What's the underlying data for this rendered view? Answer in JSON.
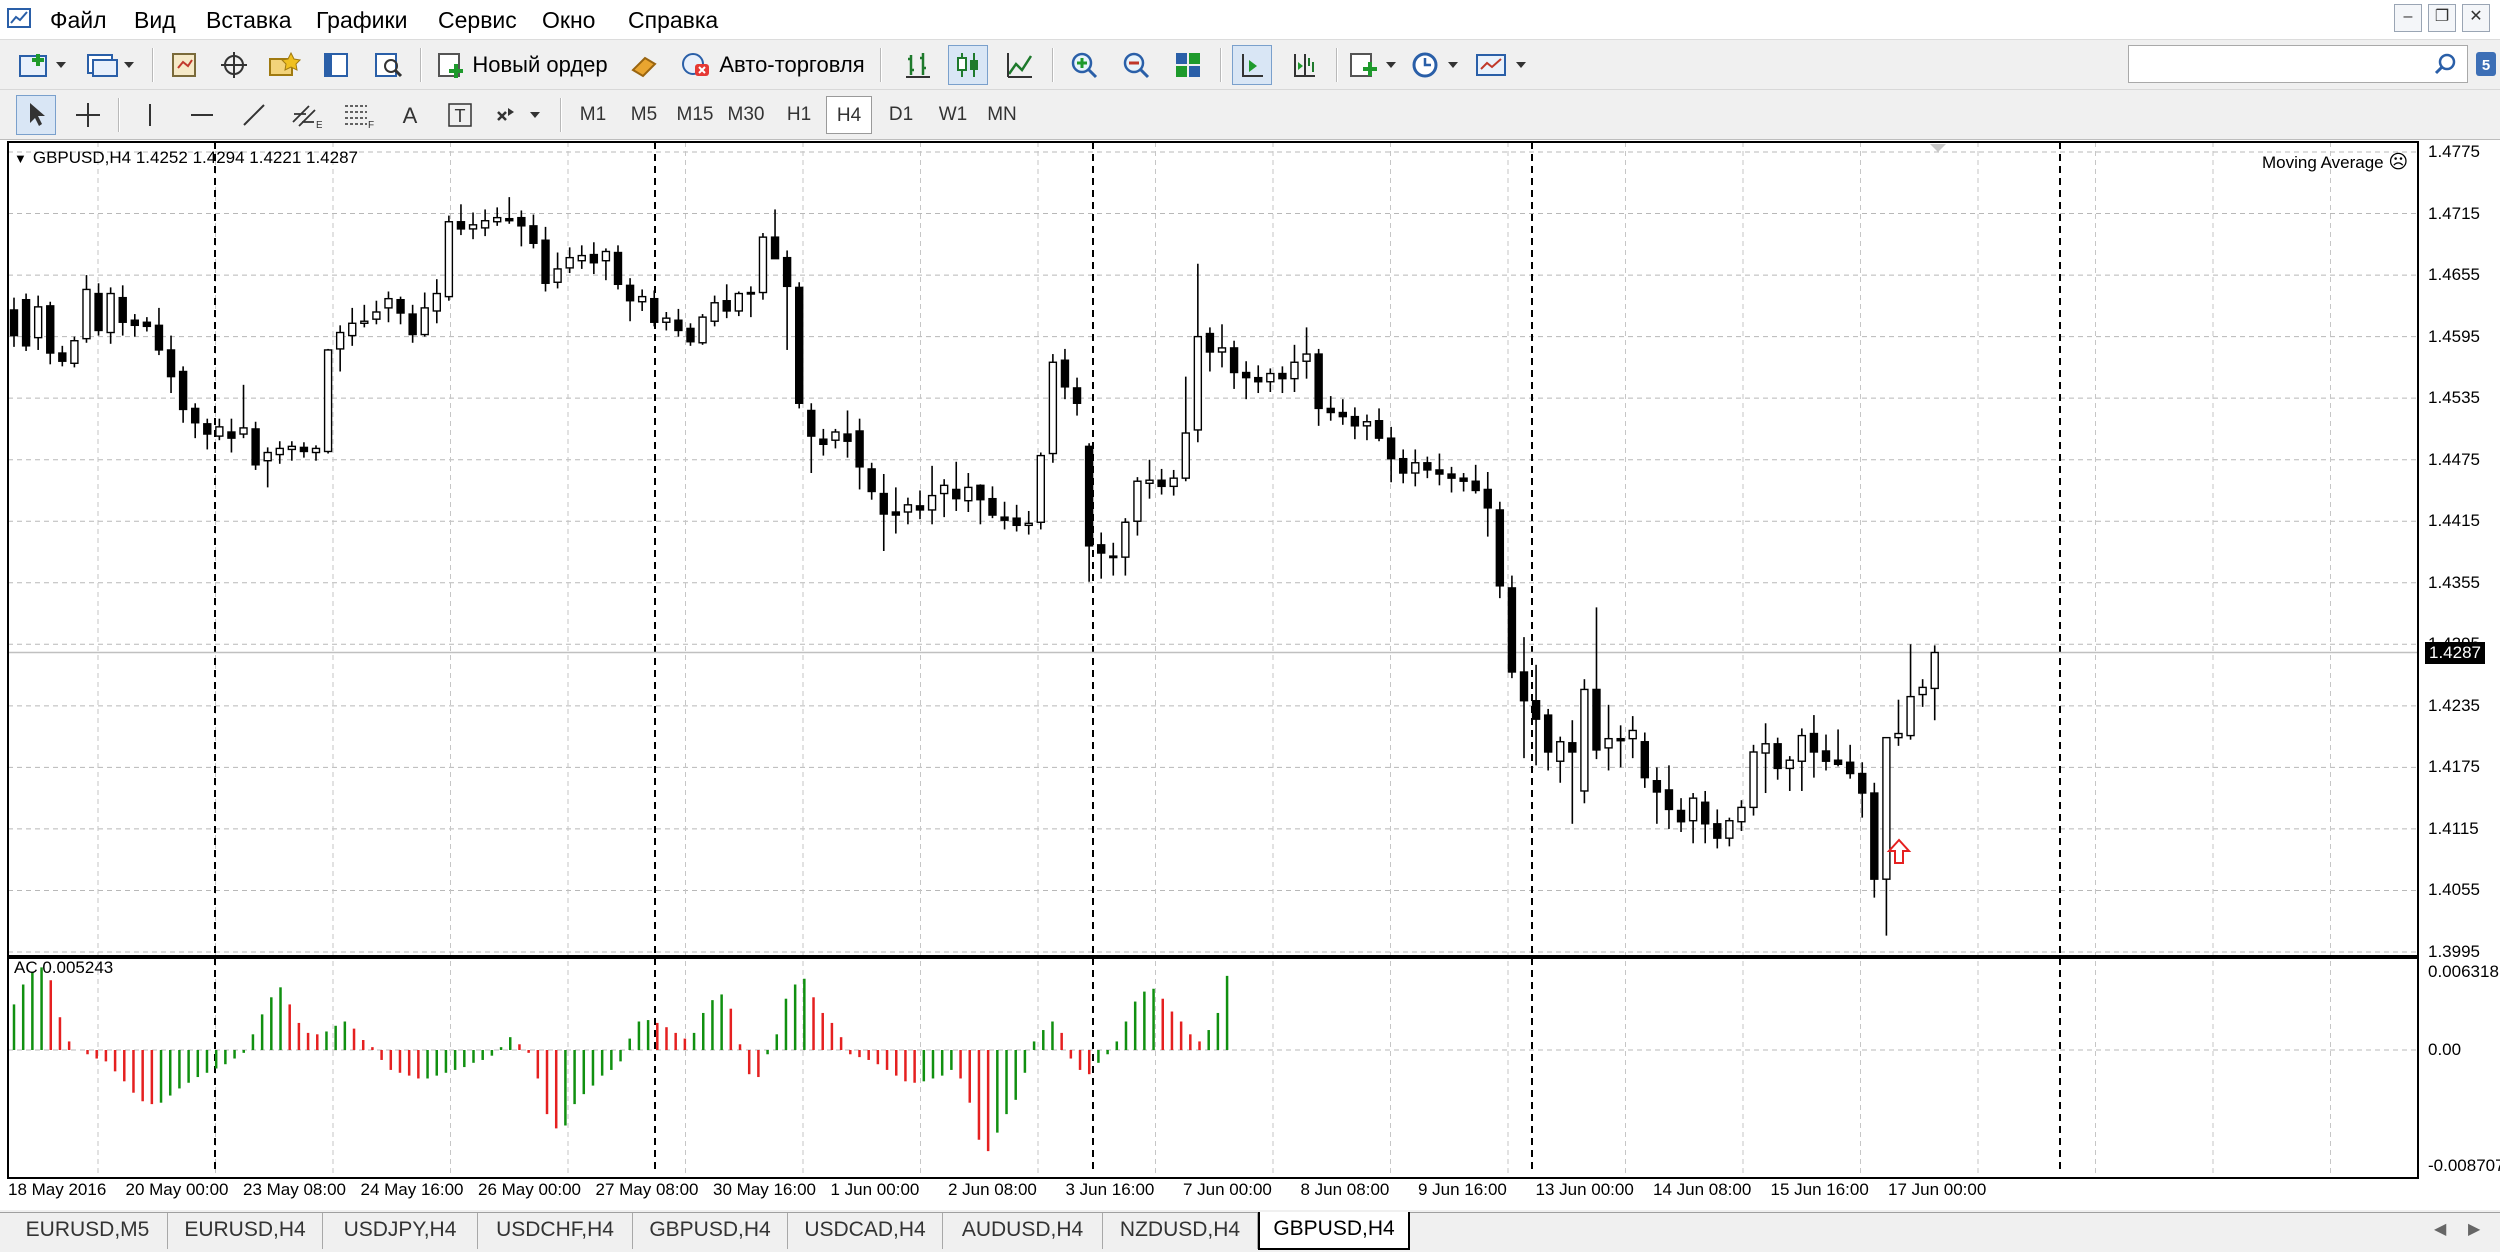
{
  "menu": {
    "items": [
      "Файл",
      "Вид",
      "Вставка",
      "Графики",
      "Сервис",
      "Окно",
      "Справка"
    ]
  },
  "toolbar": {
    "new_order_label": "Новый ордер",
    "auto_trading_label": "Авто-торговля",
    "search_value": ""
  },
  "timeframes": [
    "M1",
    "M5",
    "M15",
    "M30",
    "H1",
    "H4",
    "D1",
    "W1",
    "MN"
  ],
  "active_timeframe": "H4",
  "chart": {
    "info": "GBPUSD,H4  1.4252 1.4294 1.4221 1.4287",
    "indicator_label": "Moving Average",
    "current_price": "1.4287",
    "ac_label": "AC 0.005243",
    "price_ticks": [
      "1.4775",
      "1.4715",
      "1.4655",
      "1.4595",
      "1.4535",
      "1.4475",
      "1.4415",
      "1.4355",
      "1.4295",
      "1.4235",
      "1.4175",
      "1.4115",
      "1.4055",
      "1.3995"
    ],
    "ac_ticks": [
      "0.006318",
      "0.00",
      "-0.008707"
    ],
    "date_labels": [
      "18 May 2016",
      "20 May 00:00",
      "23 May 08:00",
      "24 May 16:00",
      "26 May 00:00",
      "27 May 08:00",
      "30 May 16:00",
      "1 Jun 00:00",
      "2 Jun 08:00",
      "3 Jun 16:00",
      "7 Jun 00:00",
      "8 Jun 08:00",
      "9 Jun 16:00",
      "13 Jun 00:00",
      "14 Jun 08:00",
      "15 Jun 16:00",
      "17 Jun 00:00"
    ]
  },
  "chart_data": {
    "type": "candlestick",
    "symbol": "GBPUSD",
    "timeframe": "H4",
    "ylim": [
      1.3995,
      1.4775
    ],
    "candles": [
      [
        1.4621,
        1.4633,
        1.4585,
        1.4596
      ],
      [
        1.4631,
        1.4637,
        1.4581,
        1.4586
      ],
      [
        1.4594,
        1.4635,
        1.4582,
        1.4624
      ],
      [
        1.4625,
        1.4629,
        1.4568,
        1.4579
      ],
      [
        1.4579,
        1.4586,
        1.4566,
        1.4571
      ],
      [
        1.4569,
        1.4595,
        1.4565,
        1.4591
      ],
      [
        1.4593,
        1.4655,
        1.4589,
        1.4641
      ],
      [
        1.4637,
        1.4647,
        1.4596,
        1.4601
      ],
      [
        1.4599,
        1.4643,
        1.4588,
        1.4637
      ],
      [
        1.4633,
        1.4645,
        1.4596,
        1.4609
      ],
      [
        1.4611,
        1.4617,
        1.4595,
        1.4606
      ],
      [
        1.4609,
        1.4614,
        1.46,
        1.4605
      ],
      [
        1.4606,
        1.4623,
        1.4577,
        1.4582
      ],
      [
        1.4582,
        1.4596,
        1.454,
        1.4556
      ],
      [
        1.4561,
        1.4566,
        1.4511,
        1.4524
      ],
      [
        1.4525,
        1.453,
        1.4496,
        1.4511
      ],
      [
        1.451,
        1.4515,
        1.4485,
        1.45
      ],
      [
        1.4498,
        1.4515,
        1.4494,
        1.4507
      ],
      [
        1.4502,
        1.4515,
        1.4482,
        1.4496
      ],
      [
        1.45,
        1.4548,
        1.4496,
        1.4506
      ],
      [
        1.4505,
        1.4512,
        1.4465,
        1.447
      ],
      [
        1.4474,
        1.4487,
        1.4448,
        1.4482
      ],
      [
        1.448,
        1.4493,
        1.4471,
        1.4486
      ],
      [
        1.4485,
        1.4493,
        1.4474,
        1.4488
      ],
      [
        1.4487,
        1.4492,
        1.4477,
        1.4483
      ],
      [
        1.4482,
        1.4489,
        1.4474,
        1.4486
      ],
      [
        1.4483,
        1.4583,
        1.4481,
        1.4582
      ],
      [
        1.4583,
        1.4606,
        1.4561,
        1.4599
      ],
      [
        1.4596,
        1.4623,
        1.4586,
        1.4608
      ],
      [
        1.4608,
        1.4626,
        1.4604,
        1.461
      ],
      [
        1.4612,
        1.463,
        1.4607,
        1.4619
      ],
      [
        1.4623,
        1.4639,
        1.4609,
        1.4632
      ],
      [
        1.4631,
        1.4634,
        1.4607,
        1.4618
      ],
      [
        1.4617,
        1.4626,
        1.4589,
        1.4597
      ],
      [
        1.4597,
        1.4638,
        1.4595,
        1.4623
      ],
      [
        1.462,
        1.4651,
        1.4608,
        1.4637
      ],
      [
        1.4634,
        1.4713,
        1.463,
        1.4707
      ],
      [
        1.4707,
        1.4724,
        1.4694,
        1.47
      ],
      [
        1.47,
        1.4716,
        1.469,
        1.4704
      ],
      [
        1.4701,
        1.4719,
        1.4693,
        1.4708
      ],
      [
        1.4707,
        1.4721,
        1.4703,
        1.4711
      ],
      [
        1.471,
        1.4731,
        1.4705,
        1.4708
      ],
      [
        1.4711,
        1.4718,
        1.4683,
        1.4703
      ],
      [
        1.4703,
        1.4714,
        1.4681,
        1.4686
      ],
      [
        1.4689,
        1.4702,
        1.4639,
        1.4647
      ],
      [
        1.4648,
        1.4677,
        1.4642,
        1.4661
      ],
      [
        1.4662,
        1.4682,
        1.4657,
        1.4672
      ],
      [
        1.4669,
        1.4684,
        1.4661,
        1.4674
      ],
      [
        1.4675,
        1.4687,
        1.4656,
        1.4667
      ],
      [
        1.4669,
        1.4681,
        1.465,
        1.4678
      ],
      [
        1.4677,
        1.4684,
        1.4641,
        1.4646
      ],
      [
        1.4645,
        1.4652,
        1.461,
        1.463
      ],
      [
        1.4629,
        1.4641,
        1.462,
        1.4634
      ],
      [
        1.4632,
        1.464,
        1.4605,
        1.4609
      ],
      [
        1.4609,
        1.4619,
        1.4601,
        1.4613
      ],
      [
        1.4611,
        1.4622,
        1.4595,
        1.4601
      ],
      [
        1.4603,
        1.4608,
        1.4586,
        1.459
      ],
      [
        1.4589,
        1.4617,
        1.4587,
        1.4614
      ],
      [
        1.461,
        1.4635,
        1.4605,
        1.4628
      ],
      [
        1.463,
        1.4646,
        1.4613,
        1.462
      ],
      [
        1.462,
        1.4639,
        1.4615,
        1.4637
      ],
      [
        1.4638,
        1.4644,
        1.4614,
        1.4637
      ],
      [
        1.4638,
        1.4696,
        1.4631,
        1.4692
      ],
      [
        1.4692,
        1.4719,
        1.4681,
        1.4671
      ],
      [
        1.4672,
        1.4679,
        1.4582,
        1.4644
      ],
      [
        1.4643,
        1.4648,
        1.4525,
        1.453
      ],
      [
        1.4523,
        1.453,
        1.4462,
        1.4498
      ],
      [
        1.4495,
        1.4505,
        1.4479,
        1.449
      ],
      [
        1.4494,
        1.4505,
        1.4486,
        1.4502
      ],
      [
        1.45,
        1.4523,
        1.4477,
        1.4493
      ],
      [
        1.4503,
        1.4515,
        1.4446,
        1.4468
      ],
      [
        1.4466,
        1.4472,
        1.4436,
        1.4444
      ],
      [
        1.4442,
        1.4461,
        1.4386,
        1.4422
      ],
      [
        1.4424,
        1.4448,
        1.4403,
        1.4421
      ],
      [
        1.4424,
        1.4438,
        1.4412,
        1.4431
      ],
      [
        1.443,
        1.4445,
        1.4417,
        1.4426
      ],
      [
        1.4426,
        1.4469,
        1.4412,
        1.444
      ],
      [
        1.4442,
        1.4456,
        1.4419,
        1.445
      ],
      [
        1.4446,
        1.4473,
        1.4425,
        1.4437
      ],
      [
        1.4435,
        1.4462,
        1.4424,
        1.4448
      ],
      [
        1.445,
        1.4451,
        1.4412,
        1.4436
      ],
      [
        1.4437,
        1.4449,
        1.4418,
        1.4421
      ],
      [
        1.4419,
        1.4434,
        1.4407,
        1.4416
      ],
      [
        1.4418,
        1.4431,
        1.4405,
        1.4411
      ],
      [
        1.4411,
        1.4425,
        1.4402,
        1.4413
      ],
      [
        1.4414,
        1.4482,
        1.4407,
        1.4479
      ],
      [
        1.4481,
        1.4578,
        1.4472,
        1.457
      ],
      [
        1.4572,
        1.4583,
        1.4534,
        1.4546
      ],
      [
        1.4545,
        1.4555,
        1.4518,
        1.453
      ],
      [
        1.4488,
        1.4491,
        1.4356,
        1.4391
      ],
      [
        1.4392,
        1.4404,
        1.4359,
        1.4384
      ],
      [
        1.4381,
        1.4394,
        1.4362,
        1.438
      ],
      [
        1.438,
        1.4418,
        1.4362,
        1.4414
      ],
      [
        1.4415,
        1.4458,
        1.4401,
        1.4454
      ],
      [
        1.4452,
        1.4475,
        1.4437,
        1.4455
      ],
      [
        1.4455,
        1.4466,
        1.4441,
        1.4449
      ],
      [
        1.4449,
        1.4465,
        1.444,
        1.4457
      ],
      [
        1.4457,
        1.4556,
        1.4454,
        1.4501
      ],
      [
        1.4504,
        1.4666,
        1.4492,
        1.4595
      ],
      [
        1.4598,
        1.4604,
        1.4561,
        1.458
      ],
      [
        1.458,
        1.4607,
        1.4565,
        1.4584
      ],
      [
        1.4584,
        1.4591,
        1.4544,
        1.456
      ],
      [
        1.456,
        1.4571,
        1.4534,
        1.4555
      ],
      [
        1.4555,
        1.4567,
        1.454,
        1.4551
      ],
      [
        1.4551,
        1.4564,
        1.4541,
        1.4559
      ],
      [
        1.4559,
        1.4566,
        1.454,
        1.4554
      ],
      [
        1.4554,
        1.4587,
        1.4541,
        1.457
      ],
      [
        1.4571,
        1.4604,
        1.4554,
        1.4578
      ],
      [
        1.4578,
        1.4583,
        1.4508,
        1.4525
      ],
      [
        1.4525,
        1.4537,
        1.4513,
        1.4521
      ],
      [
        1.4521,
        1.4534,
        1.4509,
        1.4517
      ],
      [
        1.4517,
        1.4526,
        1.4495,
        1.4508
      ],
      [
        1.4508,
        1.4519,
        1.4494,
        1.4512
      ],
      [
        1.4513,
        1.4525,
        1.4493,
        1.4496
      ],
      [
        1.4496,
        1.4507,
        1.4453,
        1.4476
      ],
      [
        1.4476,
        1.4485,
        1.4452,
        1.4462
      ],
      [
        1.4462,
        1.4485,
        1.4449,
        1.4472
      ],
      [
        1.4472,
        1.4478,
        1.4457,
        1.4465
      ],
      [
        1.4465,
        1.4481,
        1.445,
        1.4461
      ],
      [
        1.4461,
        1.4468,
        1.4443,
        1.4457
      ],
      [
        1.4457,
        1.4462,
        1.4444,
        1.4454
      ],
      [
        1.4454,
        1.447,
        1.4442,
        1.4445
      ],
      [
        1.4446,
        1.4463,
        1.44,
        1.4428
      ],
      [
        1.4426,
        1.4434,
        1.434,
        1.4352
      ],
      [
        1.435,
        1.4362,
        1.4262,
        1.4268
      ],
      [
        1.4268,
        1.4302,
        1.4184,
        1.424
      ],
      [
        1.424,
        1.4275,
        1.4177,
        1.4222
      ],
      [
        1.4226,
        1.4232,
        1.4172,
        1.419
      ],
      [
        1.4181,
        1.4205,
        1.416,
        1.42
      ],
      [
        1.4199,
        1.4221,
        1.412,
        1.419
      ],
      [
        1.4152,
        1.4261,
        1.414,
        1.4251
      ],
      [
        1.4251,
        1.4331,
        1.4183,
        1.4192
      ],
      [
        1.4194,
        1.4236,
        1.4172,
        1.4203
      ],
      [
        1.4203,
        1.4216,
        1.4175,
        1.4201
      ],
      [
        1.4203,
        1.4225,
        1.4184,
        1.4211
      ],
      [
        1.42,
        1.4209,
        1.4155,
        1.4165
      ],
      [
        1.4162,
        1.4175,
        1.412,
        1.4151
      ],
      [
        1.4153,
        1.4177,
        1.4115,
        1.4134
      ],
      [
        1.4133,
        1.4145,
        1.4112,
        1.4122
      ],
      [
        1.4123,
        1.415,
        1.4101,
        1.4145
      ],
      [
        1.4141,
        1.4152,
        1.4101,
        1.412
      ],
      [
        1.412,
        1.4134,
        1.4096,
        1.4106
      ],
      [
        1.4106,
        1.4126,
        1.4098,
        1.4123
      ],
      [
        1.4122,
        1.4143,
        1.4113,
        1.4136
      ],
      [
        1.4136,
        1.4197,
        1.4128,
        1.419
      ],
      [
        1.4189,
        1.4218,
        1.415,
        1.4198
      ],
      [
        1.4198,
        1.4204,
        1.4163,
        1.4174
      ],
      [
        1.4174,
        1.4186,
        1.4152,
        1.4182
      ],
      [
        1.4181,
        1.4213,
        1.4152,
        1.4206
      ],
      [
        1.4208,
        1.4226,
        1.4165,
        1.419
      ],
      [
        1.4191,
        1.4207,
        1.4172,
        1.4181
      ],
      [
        1.4182,
        1.4212,
        1.4176,
        1.4178
      ],
      [
        1.418,
        1.4197,
        1.4164,
        1.4169
      ],
      [
        1.4169,
        1.418,
        1.4126,
        1.415
      ],
      [
        1.415,
        1.416,
        1.4048,
        1.4066
      ],
      [
        1.4066,
        1.4204,
        1.4011,
        1.4204
      ],
      [
        1.4204,
        1.4241,
        1.4196,
        1.4208
      ],
      [
        1.4206,
        1.4295,
        1.4202,
        1.4244
      ],
      [
        1.4246,
        1.4261,
        1.4234,
        1.4253
      ],
      [
        1.4252,
        1.4294,
        1.4221,
        1.4287
      ]
    ],
    "ac_values": [
      0.0032,
      0.0046,
      0.0055,
      0.0058,
      0.0049,
      0.0023,
      0.0006,
      0.0,
      -0.0003,
      -0.0006,
      -0.0008,
      -0.0015,
      -0.0022,
      -0.003,
      -0.0036,
      -0.0038,
      -0.0037,
      -0.0032,
      -0.0027,
      -0.0023,
      -0.0019,
      -0.0016,
      -0.0013,
      -0.001,
      -0.0006,
      -0.0002,
      0.0011,
      0.0025,
      0.0037,
      0.0044,
      0.0032,
      0.0019,
      0.0012,
      0.0011,
      0.0013,
      0.0017,
      0.002,
      0.0015,
      0.0007,
      0.0002,
      -0.0007,
      -0.0014,
      -0.0016,
      -0.0018,
      -0.002,
      -0.002,
      -0.0018,
      -0.0016,
      -0.0014,
      -0.0012,
      -0.0009,
      -0.0007,
      -0.0004,
      0.0002,
      0.0009,
      0.0004,
      -0.0002,
      -0.002,
      -0.0045,
      -0.0055,
      -0.0053,
      -0.0038,
      -0.0031,
      -0.0025,
      -0.0018,
      -0.0014,
      -0.0008,
      0.0008,
      0.002,
      0.0021,
      0.0019,
      0.0016,
      0.0012,
      0.0008,
      0.0012,
      0.0026,
      0.0035,
      0.0039,
      0.0029,
      0.0004,
      -0.0017,
      -0.0019,
      -0.0003,
      0.0011,
      0.0036,
      0.0046,
      0.005,
      0.0037,
      0.0026,
      0.0019,
      0.0009,
      -0.0003,
      -0.0005,
      -0.0007,
      -0.001,
      -0.0014,
      -0.0018,
      -0.0022,
      -0.0023,
      -0.0022,
      -0.002,
      -0.0018,
      -0.0014,
      -0.002,
      -0.0037,
      -0.0063,
      -0.0071,
      -0.0058,
      -0.0045,
      -0.0035,
      -0.0016,
      0.0006,
      0.0014,
      0.002,
      0.0012,
      -0.0006,
      -0.0014,
      -0.0017,
      -0.0009,
      -0.0003,
      0.0006,
      0.002,
      0.0034,
      0.0041,
      0.0043,
      0.0036,
      0.0027,
      0.002,
      0.0011,
      0.0006,
      0.0014,
      0.0026,
      0.0052
    ],
    "ac_ylim": [
      -0.008707,
      0.006318
    ]
  },
  "tabs": {
    "items": [
      "EURUSD,M5",
      "EURUSD,H4",
      "USDJPY,H4",
      "USDCHF,H4",
      "GBPUSD,H4",
      "USDCAD,H4",
      "AUDUSD,H4",
      "NZDUSD,H4",
      "GBPUSD,H4"
    ],
    "active_index": 8
  },
  "colors": {
    "ac_up": "#109010",
    "ac_down": "#e52020",
    "signal_arrow": "#e52020",
    "bid_line": "#c0c0c0"
  }
}
